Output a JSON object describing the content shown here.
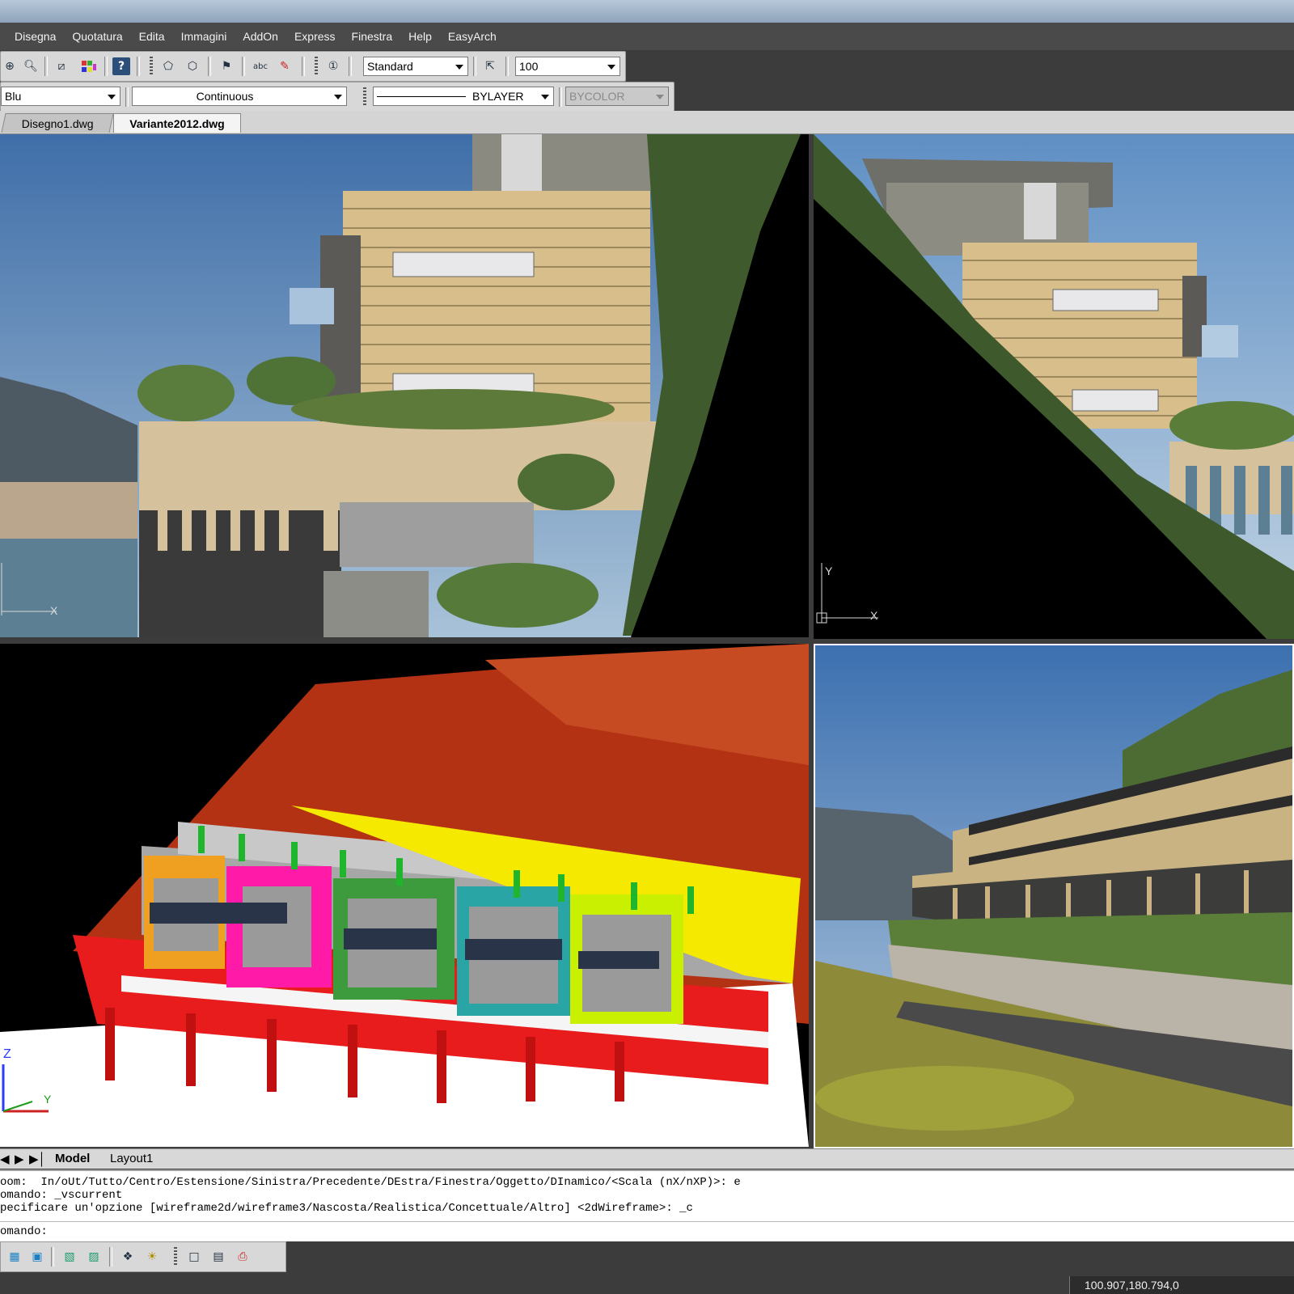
{
  "menu": [
    "Disegna",
    "Quotatura",
    "Edita",
    "Immagini",
    "AddOn",
    "Express",
    "Finestra",
    "Help",
    "EasyArch"
  ],
  "toolbar1": {
    "icons": [
      "zoom-previous-icon",
      "zoom-realtime-icon",
      "no-plot-icon",
      "color-palette-icon",
      "help-icon",
      "block-icon",
      "block-attribute-icon",
      "find-icon",
      "spellcheck-icon",
      "text-edit-icon",
      "grip-icon",
      "text-style-icon",
      "dimension-style-icon"
    ],
    "text_style": "Standard",
    "scale": "100"
  },
  "toolbar2": {
    "color": "Blu",
    "linetype": "Continuous",
    "lineweight": "BYLAYER",
    "plotstyle": "BYCOLOR"
  },
  "tabs": [
    "Disegno1.dwg",
    "Variante2012.dwg"
  ],
  "viewports": {
    "top_left": {
      "axis_x": "X"
    },
    "top_right": {
      "axis_x": "X",
      "axis_y": "Y"
    },
    "bottom_left": {
      "axis_y": "Y",
      "axis_z": "Z"
    }
  },
  "layout_tabs": [
    "Model",
    "Layout1"
  ],
  "command": {
    "history": [
      "oom:  In/oUt/Tutto/Centro/Estensione/Sinistra/Precedente/DEstra/Finestra/Oggetto/DInamico/<Scala (nX/nXP)>: e",
      "omando: _vscurrent",
      "pecificare un'opzione [wireframe2d/wireframe3/Nascosta/Realistica/Concettuale/Altro] <2dWireframe>: _c"
    ],
    "prompt": "omando:"
  },
  "bottom_toolbar_icons": [
    "render-icon",
    "solid-icon",
    "box-icon",
    "cylinder-icon",
    "material-icon",
    "light-icon",
    "view-icon",
    "camera-icon",
    "plot-icon"
  ],
  "status": {
    "coordinates": "100.907,180.794,0"
  },
  "colors": {
    "menubar": "#4a4a4a",
    "toolbar": "#d8d8d8",
    "sky": "#6f95bf",
    "cad_red": "#b33214"
  }
}
